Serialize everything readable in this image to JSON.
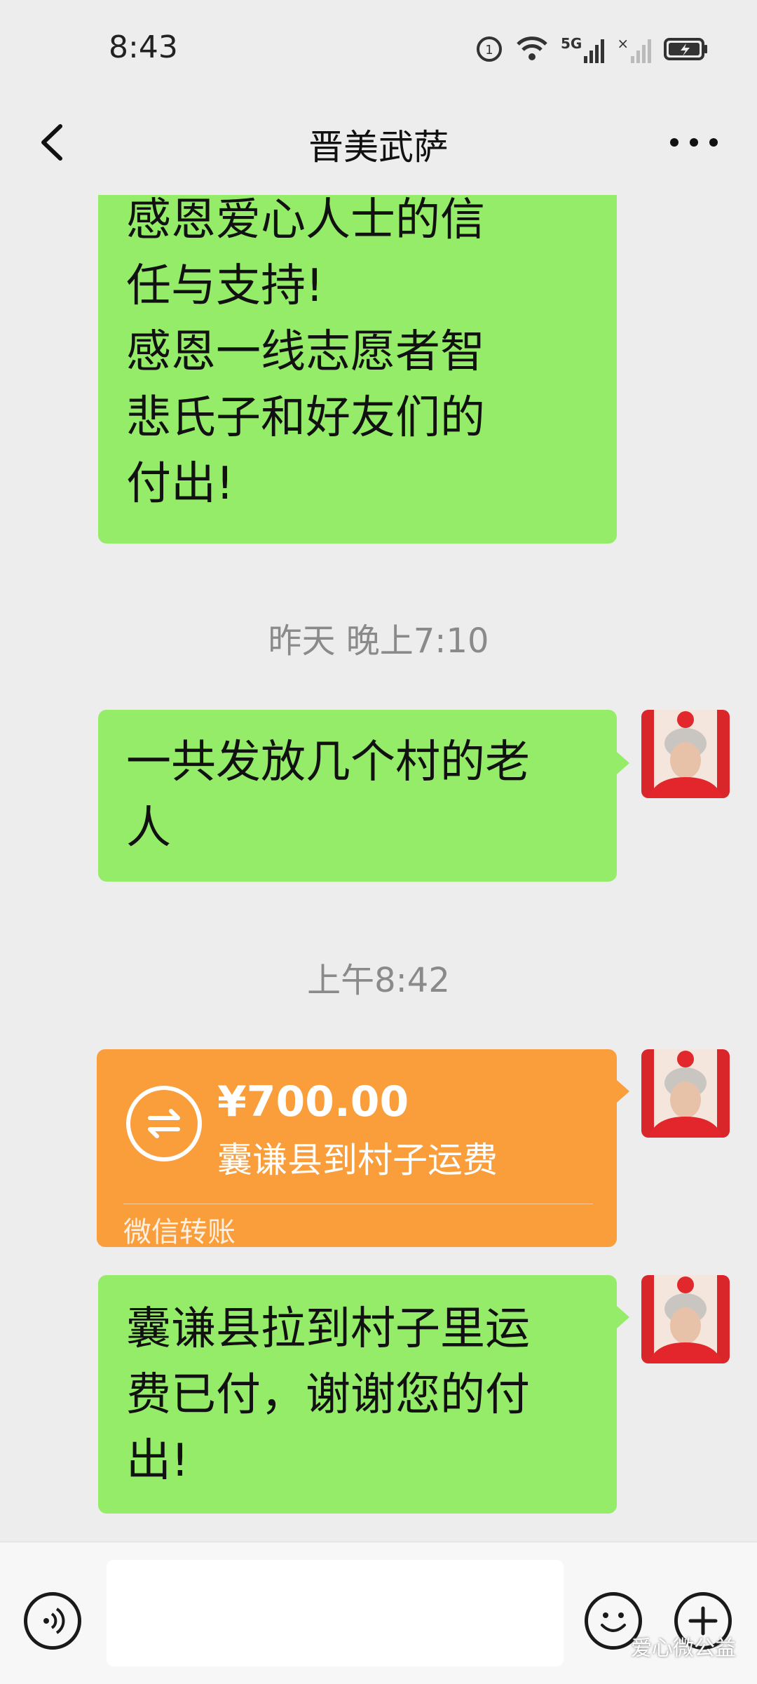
{
  "status": {
    "time": "8:43",
    "icons": [
      "data-usage-icon",
      "wifi-icon",
      "signal-5g-icon",
      "signal-icon",
      "battery-charging-icon"
    ],
    "network_label": "5G"
  },
  "header": {
    "title": "晋美武萨",
    "back_icon": "chevron-left-icon",
    "more_icon": "more-dots-icon"
  },
  "messages": [
    {
      "type": "text",
      "lines": [
        "感恩爱心人士的信",
        "任与支持!",
        "感恩一线志愿者智",
        "悲氏子和好友们的",
        "付出!"
      ]
    },
    {
      "type": "time",
      "text": "昨天 晚上7:10"
    },
    {
      "type": "text",
      "lines": [
        "一共发放几个村的老",
        "人"
      ]
    },
    {
      "type": "time",
      "text": "上午8:42"
    },
    {
      "type": "transfer",
      "amount": "¥700.00",
      "remark": "囊谦县到村子运费",
      "label": "微信转账"
    },
    {
      "type": "text",
      "lines": [
        "囊谦县拉到村子里运",
        "费已付，谢谢您的付",
        "出!"
      ]
    }
  ],
  "input_bar": {
    "value": "",
    "voice_icon": "voice-icon",
    "emoji_icon": "emoji-icon",
    "plus_icon": "plus-icon"
  },
  "watermark": "爱心微公益",
  "colors": {
    "background": "#ededed",
    "bubble": "#95ec69",
    "transfer": "#fa9d3b",
    "timestamp": "#8a8a8a"
  }
}
